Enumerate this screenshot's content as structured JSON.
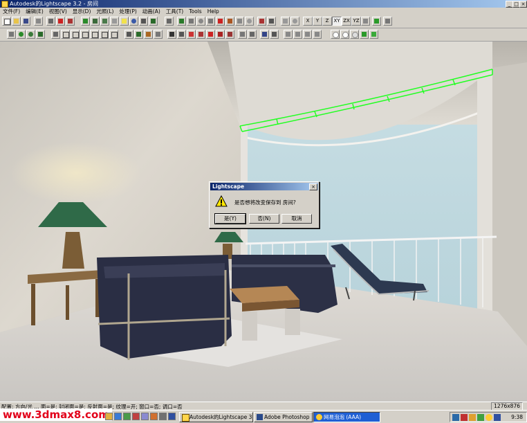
{
  "window": {
    "title": "Autodesk的Lightscape 3.2 - 房间",
    "controls": {
      "minimize": "_",
      "maximize": "□",
      "close": "×"
    }
  },
  "menu": [
    "文件(F)",
    "编辑(E)",
    "视图(V)",
    "显示(D)",
    "光照(L)",
    "处理(P)",
    "动画(A)",
    "工具(T)",
    "Tools",
    "Help"
  ],
  "toolbar": {
    "axis_buttons": [
      "X",
      "Y",
      "Z",
      "XY",
      "ZX",
      "YZ"
    ]
  },
  "dialog": {
    "title": "Lightscape",
    "message": "是否想将改变保存到 房间?",
    "buttons": {
      "yes": "是(Y)",
      "no": "否(N)",
      "cancel": "取消"
    },
    "close": "×",
    "icon": "warning-icon"
  },
  "status": {
    "message": "配置: 方向/光 ... 面=是; 封闭面=是; 反射面=是; 纹理=开; 窗口=否; 调口=否",
    "resolution": "1276x876"
  },
  "taskbar": {
    "tasks": [
      "Autodesk的Lightscape 3....",
      "Adobe Photoshop",
      "网易泡泡 (AAA)"
    ],
    "clock": "9:38"
  },
  "watermark": "www.3dmax8.com",
  "colors": {
    "title_gradient_start": "#0a246a",
    "title_gradient_end": "#a6caf0",
    "selection_outline": "#22ff22",
    "watermark": "#e2001a",
    "active_task": "#1f5fd4"
  }
}
